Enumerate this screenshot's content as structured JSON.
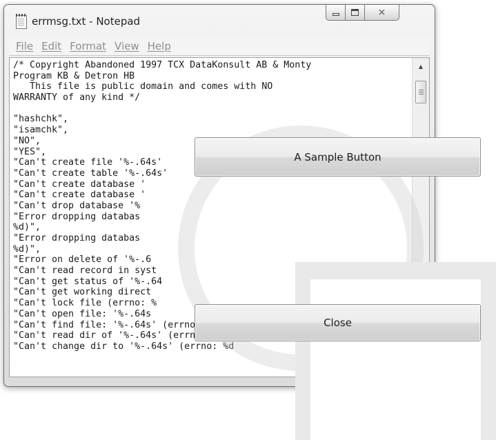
{
  "notepad": {
    "title": "errmsg.txt - Notepad",
    "window_buttons": {
      "minimize": "minimize-icon",
      "maximize": "maximize-icon",
      "close": "×"
    },
    "menu": [
      "File",
      "Edit",
      "Format",
      "View",
      "Help"
    ],
    "text_lines": [
      "/* Copyright Abandoned 1997 TCX DataKonsult AB & Monty",
      "Program KB & Detron HB",
      "   This file is public domain and comes with NO",
      "WARRANTY of any kind */",
      "",
      "\"hashchk\",",
      "\"isamchk\",",
      "\"NO\",",
      "\"YES\",",
      "\"Can't create file '%-.64s'",
      "\"Can't create table '%-.64s'",
      "\"Can't create database '",
      "\"Can't create database '",
      "\"Can't drop database '%",
      "\"Error dropping databas",
      "%d)\",",
      "\"Error dropping databas",
      "%d)\",",
      "\"Error on delete of '%-.6",
      "\"Can't read record in syst",
      "\"Can't get status of '%-.64",
      "\"Can't get working direct",
      "\"Can't lock file (errno: %",
      "\"Can't open file: '%-.64s",
      "\"Can't find file: '%-.64s' (errno: %d)",
      "\"Can't read dir of '%-.64s' (errno: %d)\"",
      "\"Can't change dir to '%-.64s' (errno: %d"
    ]
  },
  "buttons": {
    "sample": "A Sample Button",
    "close": "Close"
  },
  "colors": {
    "window_frame": "#dcdcdc",
    "menu_text": "#8e8e8e",
    "button_face": "#e6e6e6",
    "overlay_ring": "#cdcdcd",
    "panel": "#e9e9e9"
  }
}
